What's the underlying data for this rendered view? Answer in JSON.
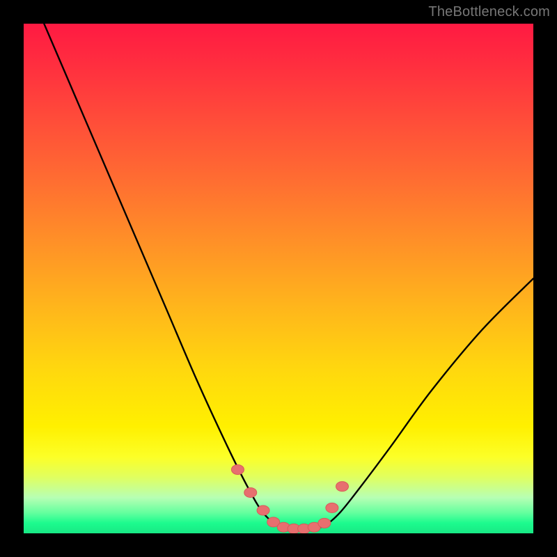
{
  "watermark": "TheBottleneck.com",
  "chart_data": {
    "type": "line",
    "title": "",
    "xlabel": "",
    "ylabel": "",
    "xlim": [
      0,
      100
    ],
    "ylim": [
      0,
      100
    ],
    "grid": false,
    "series": [
      {
        "name": "bottleneck-curve",
        "x": [
          4,
          10,
          16,
          22,
          28,
          34,
          40,
          44,
          47,
          50,
          53,
          56,
          59,
          62,
          66,
          72,
          80,
          90,
          100
        ],
        "values": [
          100,
          86,
          72,
          58,
          44,
          30,
          17,
          9,
          4,
          1.5,
          0.8,
          0.8,
          1.5,
          4,
          9,
          17,
          28,
          40,
          50
        ]
      }
    ],
    "markers": {
      "name": "highlight-points",
      "x": [
        42,
        44.5,
        47,
        49,
        51,
        53,
        55,
        57,
        59,
        60.5,
        62.5
      ],
      "values": [
        12.5,
        8,
        4.5,
        2.2,
        1.2,
        0.9,
        0.9,
        1.2,
        2,
        5,
        9.2
      ]
    },
    "background_gradient": {
      "from": "#ff1a42",
      "to": "#18e884"
    }
  }
}
